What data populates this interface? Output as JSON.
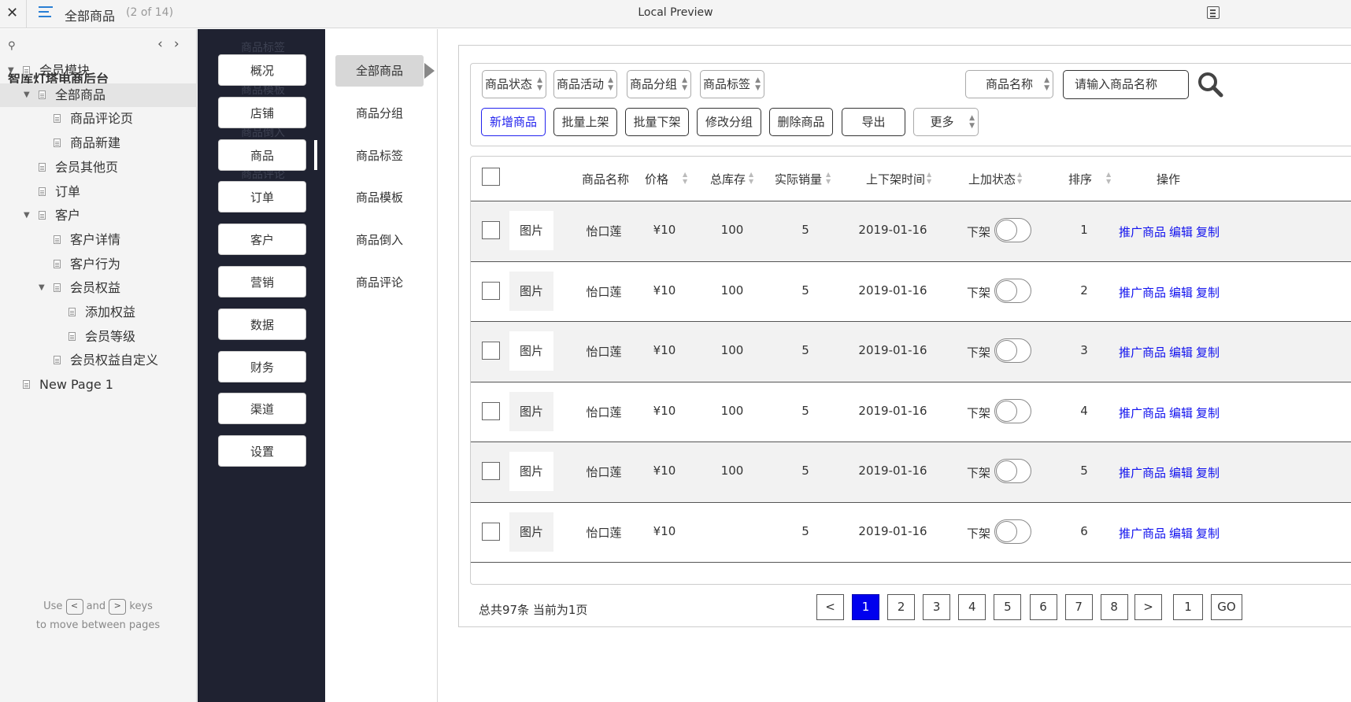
{
  "topbar": {
    "title": "全部商品",
    "count": "(2 of 14)",
    "center_title": "Local Preview"
  },
  "tree": {
    "root": "智库灯塔电商后台",
    "items": [
      {
        "label": "会员模块",
        "level": 1,
        "expanded": true,
        "selected": false
      },
      {
        "label": "全部商品",
        "level": 2,
        "expanded": true,
        "selected": true
      },
      {
        "label": "商品评论页",
        "level": 3,
        "expanded": false,
        "selected": false
      },
      {
        "label": "商品新建",
        "level": 3,
        "expanded": false,
        "selected": false
      },
      {
        "label": "会员其他页",
        "level": 2,
        "expanded": false,
        "selected": false
      },
      {
        "label": "订单",
        "level": 2,
        "expanded": false,
        "selected": false
      },
      {
        "label": "客户",
        "level": 2,
        "expanded": true,
        "selected": false
      },
      {
        "label": "客户详情",
        "level": 3,
        "expanded": false,
        "selected": false
      },
      {
        "label": "客户行为",
        "level": 3,
        "expanded": false,
        "selected": false
      },
      {
        "label": "会员权益",
        "level": 3,
        "expanded": true,
        "selected": false
      },
      {
        "label": "添加权益",
        "level": 4,
        "expanded": false,
        "selected": false
      },
      {
        "label": "会员等级",
        "level": 4,
        "expanded": false,
        "selected": false
      },
      {
        "label": "会员权益自定义",
        "level": 3,
        "expanded": false,
        "selected": false
      },
      {
        "label": "New Page 1",
        "level": 1,
        "expanded": false,
        "selected": false
      }
    ],
    "help_use": "Use",
    "help_and": "and",
    "help_keys": "keys",
    "help_line2": "to move between pages",
    "key_prev": "<",
    "key_next": ">"
  },
  "ghost_labels": [
    "商品标签",
    "商品模板",
    "商品倒入",
    "商品评论"
  ],
  "nav": {
    "items": [
      "概况",
      "店铺",
      "商品",
      "订单",
      "客户",
      "营销",
      "数据",
      "财务",
      "渠道",
      "设置"
    ],
    "active_index": 2
  },
  "subnav": {
    "items": [
      "全部商品",
      "商品分组",
      "商品标签",
      "商品模板",
      "商品倒入",
      "商品评论"
    ],
    "active_index": 0
  },
  "filters": {
    "selects": [
      "商品状态",
      "商品活动",
      "商品分组",
      "商品标签"
    ],
    "name_select": "商品名称",
    "name_input": "请输入商品名称"
  },
  "actions": {
    "add": "新增商品",
    "batch_up": "批量上架",
    "batch_down": "批量下架",
    "modify_group": "修改分组",
    "delete": "删除商品",
    "export": "导出",
    "more": "更多"
  },
  "table": {
    "headers": {
      "name": "商品名称",
      "price": "价格",
      "stock": "总库存",
      "sales": "实际销量",
      "time": "上下架时间",
      "status": "上加状态",
      "order": "排序",
      "ops": "操作"
    },
    "rows": [
      {
        "image": "图片",
        "name": "怡口莲",
        "price": "¥10",
        "stock": "100",
        "sales": "5",
        "time": "2019-01-16",
        "status": "下架",
        "toggle_on": false,
        "order": "1"
      },
      {
        "image": "图片",
        "name": "怡口莲",
        "price": "¥10",
        "stock": "100",
        "sales": "5",
        "time": "2019-01-16",
        "status": "下架",
        "toggle_on": false,
        "order": "2"
      },
      {
        "image": "图片",
        "name": "怡口莲",
        "price": "¥10",
        "stock": "100",
        "sales": "5",
        "time": "2019-01-16",
        "status": "下架",
        "toggle_on": false,
        "order": "3"
      },
      {
        "image": "图片",
        "name": "怡口莲",
        "price": "¥10",
        "stock": "100",
        "sales": "5",
        "time": "2019-01-16",
        "status": "下架",
        "toggle_on": false,
        "order": "4"
      },
      {
        "image": "图片",
        "name": "怡口莲",
        "price": "¥10",
        "stock": "100",
        "sales": "5",
        "time": "2019-01-16",
        "status": "下架",
        "toggle_on": false,
        "order": "5"
      },
      {
        "image": "图片",
        "name": "怡口莲",
        "price": "¥10",
        "stock": "",
        "sales": "5",
        "time": "2019-01-16",
        "status": "下架",
        "toggle_on": false,
        "order": "6"
      }
    ],
    "ops": {
      "promote": "推广商品",
      "edit": "编辑",
      "copy": "复制"
    }
  },
  "pagination": {
    "summary": "总共97条 当前为1页",
    "prev": "<",
    "next": ">",
    "pages": [
      "1",
      "2",
      "3",
      "4",
      "5",
      "6",
      "7",
      "8"
    ],
    "active_page": "1",
    "jump_value": "1",
    "go": "GO"
  },
  "colors": {
    "nav_dark": "#1f2231",
    "link_blue": "#1111ee",
    "active_page": "#0000ee"
  }
}
